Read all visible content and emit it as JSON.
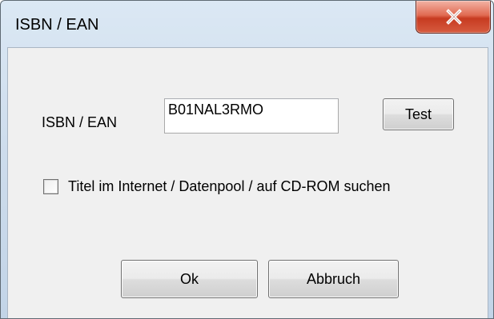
{
  "window": {
    "title": "ISBN / EAN"
  },
  "icons": {
    "close": "close-icon"
  },
  "form": {
    "isbn_label": "ISBN / EAN",
    "isbn_value": "B01NAL3RMO",
    "test_button": "Test",
    "search_online_checkbox": {
      "label": "Titel im Internet / Datenpool / auf CD-ROM suchen",
      "checked": false
    }
  },
  "buttons": {
    "ok": "Ok",
    "cancel": "Abbruch"
  },
  "colors": {
    "title_bar": "#d1e0ef",
    "close_button": "#d9553a",
    "dialog_background": "#f0f0f0"
  }
}
